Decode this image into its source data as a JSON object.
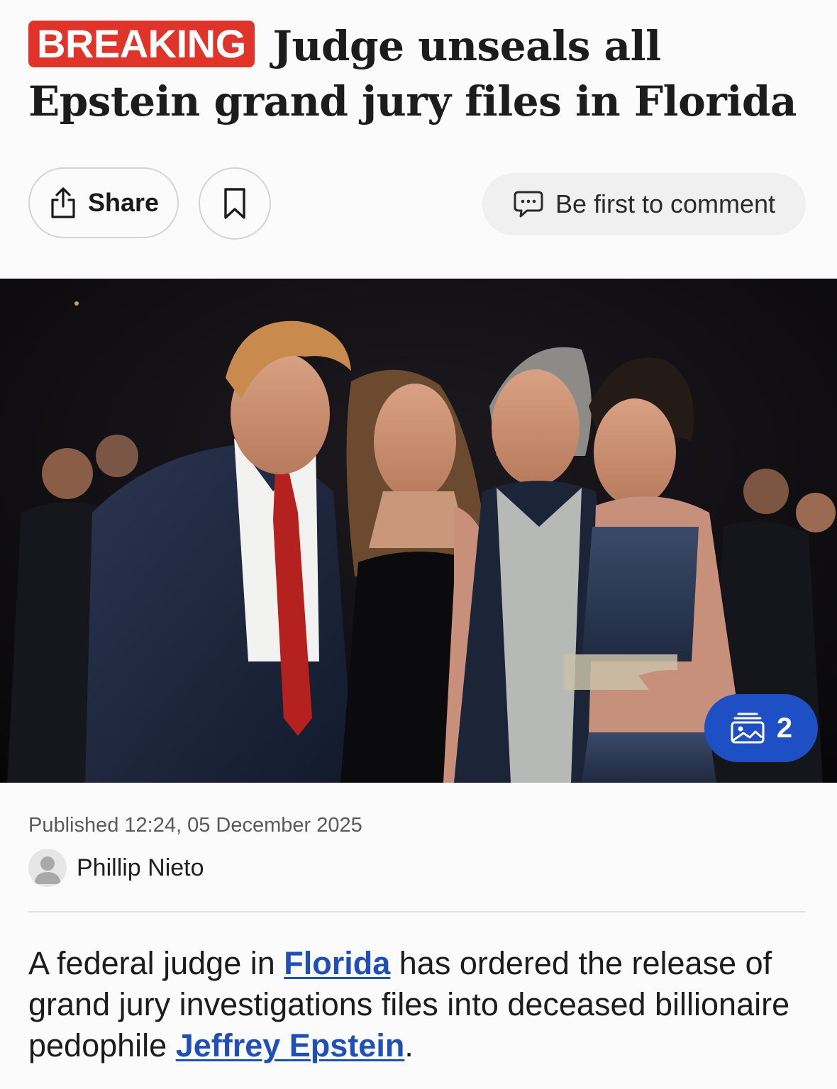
{
  "article": {
    "badge": "BREAKING",
    "title": "Judge unseals all Epstein grand jury files in Florida"
  },
  "actions": {
    "share_label": "Share",
    "comment_label": "Be first to comment"
  },
  "hero": {
    "gallery_count": "2"
  },
  "meta": {
    "published": "Published 12:24, 05 December 2025",
    "author": "Phillip Nieto"
  },
  "body": {
    "p1_before": "A federal judge in ",
    "link1": "Florida",
    "p1_middle": " has ordered the release of grand jury investigations files into deceased billionaire pedophile ",
    "link2": "Jeffrey Epstein",
    "p1_after": "."
  },
  "colors": {
    "breaking_red": "#e0342a",
    "link_blue": "#1f4fb8",
    "gallery_badge_blue": "#1e4fc4"
  },
  "icons": {
    "share": "share-icon",
    "bookmark": "bookmark-icon",
    "comment": "comment-icon",
    "gallery": "gallery-icon",
    "avatar": "user-placeholder-icon"
  }
}
